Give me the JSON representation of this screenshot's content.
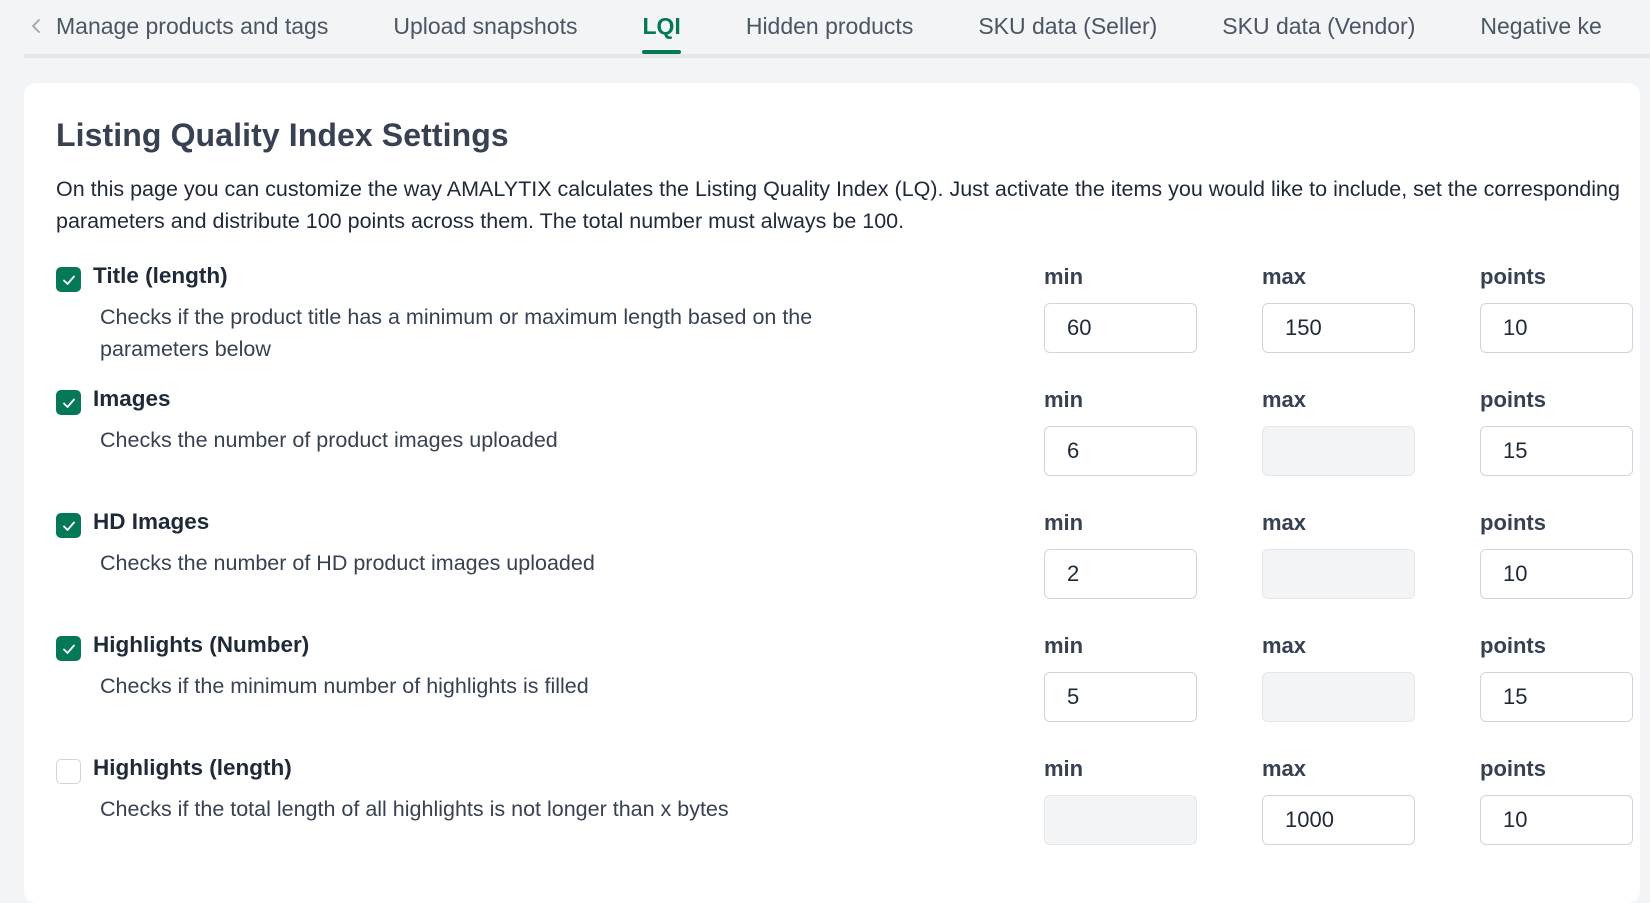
{
  "tabs": [
    {
      "label": "Manage products and tags",
      "active": false
    },
    {
      "label": "Upload snapshots",
      "active": false
    },
    {
      "label": "LQI",
      "active": true
    },
    {
      "label": "Hidden products",
      "active": false
    },
    {
      "label": "SKU data (Seller)",
      "active": false
    },
    {
      "label": "SKU data (Vendor)",
      "active": false
    },
    {
      "label": "Negative ke",
      "active": false
    }
  ],
  "page": {
    "title": "Listing Quality Index Settings",
    "description": "On this page you can customize the way AMALYTIX calculates the Listing Quality Index (LQ). Just activate the items you would like to include, set the corresponding parameters and distribute 100 points across them. The total number must always be 100."
  },
  "labels": {
    "min": "min",
    "max": "max",
    "points": "points"
  },
  "criteria": [
    {
      "title": "Title (length)",
      "description": "Checks if the product title has a minimum or maximum length based on the parameters below",
      "checked": true,
      "min": "60",
      "max": "150",
      "points": "10"
    },
    {
      "title": "Images",
      "description": "Checks the number of product images uploaded",
      "checked": true,
      "min": "6",
      "max": "",
      "points": "15"
    },
    {
      "title": "HD Images",
      "description": "Checks the number of HD product images uploaded",
      "checked": true,
      "min": "2",
      "max": "",
      "points": "10"
    },
    {
      "title": "Highlights (Number)",
      "description": "Checks if the minimum number of highlights is filled",
      "checked": true,
      "min": "5",
      "max": "",
      "points": "15"
    },
    {
      "title": "Highlights (length)",
      "description": "Checks if the total length of all highlights is not longer than x bytes",
      "checked": false,
      "min": "",
      "max": "1000",
      "points": "10"
    }
  ],
  "colors": {
    "accent": "#047857",
    "disabled_bg": "#f3f4f6",
    "border": "#d1d5db"
  }
}
